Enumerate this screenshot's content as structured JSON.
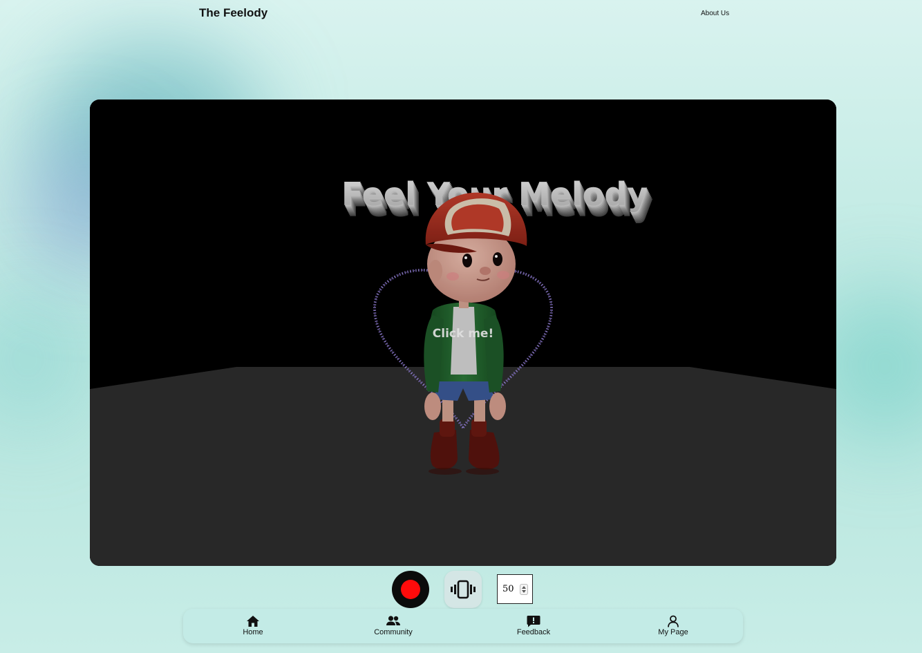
{
  "header": {
    "brand": "The Feelody",
    "about_link": "About Us"
  },
  "scene": {
    "title_3d": "Feel Your Melody",
    "title_visible_fragment_1": "Feel You",
    "title_visible_fragment_2": "elody",
    "prompt": "Click me!",
    "colors": {
      "backdrop": "#000000",
      "floor": "#2e2e2e",
      "heart_particles": "#8f7ad6"
    }
  },
  "controls": {
    "record_color": "#ff0b0b",
    "vibration_icon": "vibration-icon",
    "intensity_value": "50"
  },
  "nav": {
    "items": [
      {
        "label": "Home",
        "icon": "home-icon"
      },
      {
        "label": "Community",
        "icon": "people-icon"
      },
      {
        "label": "Feedback",
        "icon": "feedback-icon"
      },
      {
        "label": "My Page",
        "icon": "person-icon"
      }
    ]
  }
}
